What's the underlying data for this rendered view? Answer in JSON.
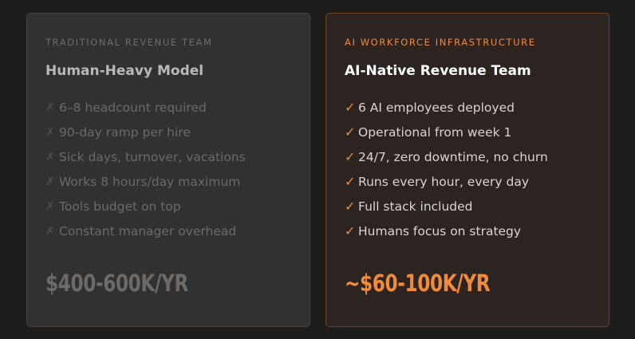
{
  "traditional": {
    "eyebrow": "TRADITIONAL REVENUE TEAM",
    "title": "Human-Heavy Model",
    "mark": "✗",
    "items": [
      "6–8 headcount required",
      "90-day ramp per hire",
      "Sick days, turnover, vacations",
      "Works 8 hours/day maximum",
      "Tools budget on top",
      "Constant manager overhead"
    ],
    "price": "$400-600K/YR"
  },
  "ai": {
    "eyebrow": "AI WORKFORCE INFRASTRUCTURE",
    "title": "AI-Native Revenue Team",
    "mark": "✓",
    "items": [
      "6 AI employees deployed",
      "Operational from week 1",
      "24/7, zero downtime, no churn",
      "Runs every hour, every day",
      "Full stack included",
      "Humans focus on strategy"
    ],
    "price": "~$60-100K/YR"
  },
  "colors": {
    "background": "#1e1d1c",
    "accent": "#f28a3c",
    "left_card": "#313131",
    "right_card": "#2c2420"
  }
}
